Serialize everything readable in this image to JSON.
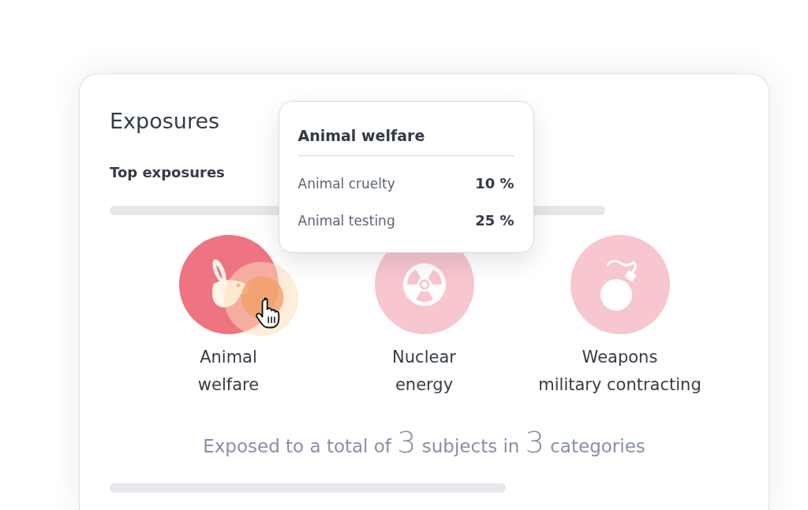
{
  "card": {
    "title": "Exposures",
    "subtitle": "Top exposures"
  },
  "categories": [
    {
      "kind": "rabbit",
      "label": "Animal\nwelfare",
      "selected": true
    },
    {
      "kind": "radiation",
      "label": "Nuclear\nenergy",
      "selected": false
    },
    {
      "kind": "bomb",
      "label": "Weapons\nmilitary contracting",
      "selected": false
    }
  ],
  "tooltip": {
    "title": "Animal welfare",
    "rows": [
      {
        "label": "Animal cruelty",
        "value": "10 %"
      },
      {
        "label": "Animal testing",
        "value": "25 %"
      }
    ]
  },
  "summary": [
    {
      "kind": "text",
      "text": "Exposed to a total of"
    },
    {
      "kind": "count",
      "text": "3"
    },
    {
      "kind": "text",
      "text": "subjects in"
    },
    {
      "kind": "count",
      "text": "3"
    },
    {
      "kind": "text",
      "text": "categories"
    }
  ]
}
